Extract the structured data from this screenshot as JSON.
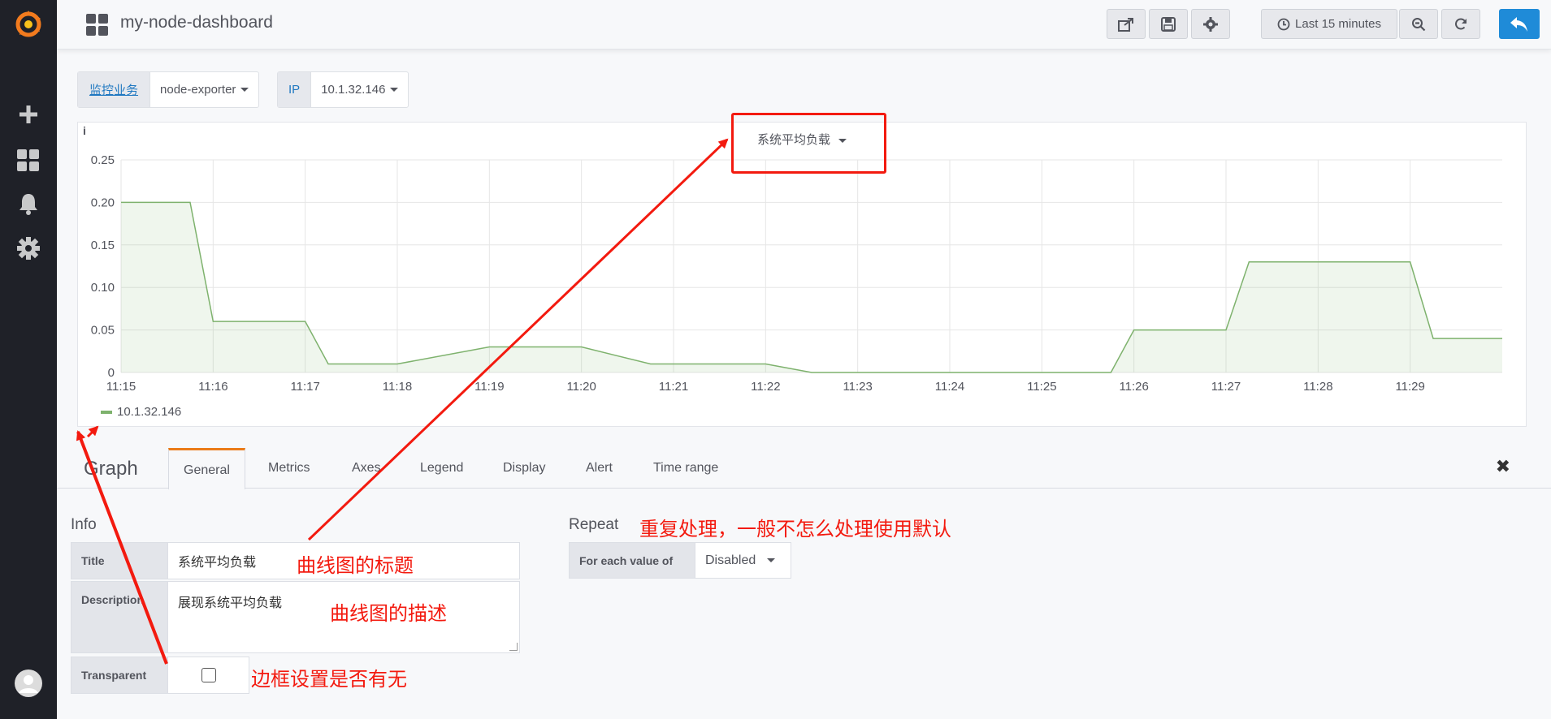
{
  "sidebar": {
    "icons": [
      "grafana-logo-icon",
      "plus-icon",
      "dashboards-icon",
      "bell-icon",
      "gear-icon",
      "user-avatar-icon"
    ]
  },
  "navbar": {
    "dashboard_title": "my-node-dashboard",
    "time_range_label": "Last 15 minutes"
  },
  "variables": [
    {
      "label": "监控业务",
      "value": "node-exporter"
    },
    {
      "label": "IP",
      "value": "10.1.32.146"
    }
  ],
  "panel": {
    "info_icon": "i",
    "title": "系统平均负载",
    "legend": "10.1.32.146"
  },
  "chart_data": {
    "type": "area",
    "x": [
      "11:15",
      "11:15:45",
      "11:16",
      "11:17",
      "11:17:15",
      "11:18",
      "11:19",
      "11:20",
      "11:20:45",
      "11:21",
      "11:22",
      "11:22:30",
      "11:23",
      "11:24",
      "11:25",
      "11:25:45",
      "11:26",
      "11:27",
      "11:27:15",
      "11:28",
      "11:29",
      "11:29:15",
      "11:30"
    ],
    "series": [
      {
        "name": "10.1.32.146",
        "color": "#7eb26d",
        "values": [
          0.2,
          0.2,
          0.06,
          0.06,
          0.01,
          0.01,
          0.03,
          0.03,
          0.01,
          0.01,
          0.01,
          0.0,
          0.0,
          0.0,
          0.0,
          0.0,
          0.05,
          0.05,
          0.13,
          0.13,
          0.13,
          0.04,
          0.04
        ]
      }
    ],
    "x_ticks": [
      "11:15",
      "11:16",
      "11:17",
      "11:18",
      "11:19",
      "11:20",
      "11:21",
      "11:22",
      "11:23",
      "11:24",
      "11:25",
      "11:26",
      "11:27",
      "11:28",
      "11:29"
    ],
    "y_ticks": [
      "0",
      "0.05",
      "0.10",
      "0.15",
      "0.20",
      "0.25"
    ],
    "ylim": [
      0,
      0.25
    ],
    "grid": true,
    "legend_position": "bottom-left"
  },
  "editor": {
    "panel_type": "Graph",
    "tabs": [
      "General",
      "Metrics",
      "Axes",
      "Legend",
      "Display",
      "Alert",
      "Time range"
    ],
    "active_tab": "General",
    "info_heading": "Info",
    "title_label": "Title",
    "title_value": "系统平均负载",
    "description_label": "Description",
    "description_value": "展现系统平均负载",
    "transparent_label": "Transparent",
    "repeat_heading": "Repeat",
    "repeat_for_label": "For each value of",
    "repeat_value": "Disabled"
  },
  "annotations": {
    "repeat_note": "重复处理，一般不怎么处理使用默认",
    "title_note": "曲线图的标题",
    "description_note": "曲线图的描述",
    "transparent_note": "边框设置是否有无",
    "color": "#f31a0f"
  }
}
